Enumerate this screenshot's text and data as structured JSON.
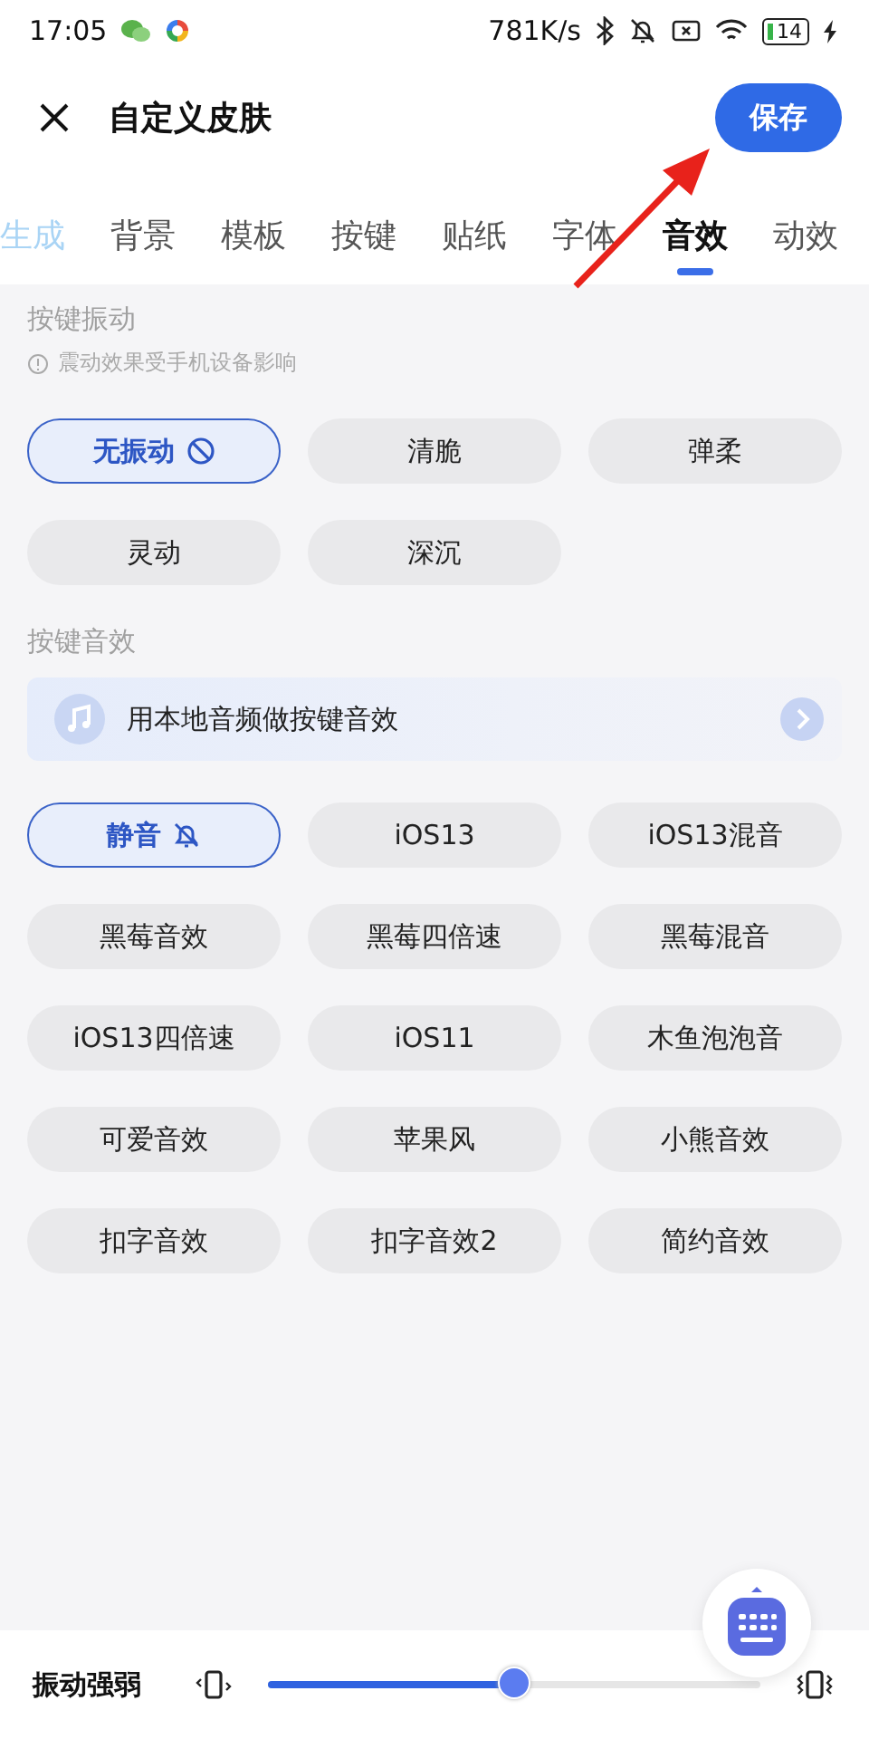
{
  "status_bar": {
    "time": "17:05",
    "speed": "781K/s",
    "battery": "14"
  },
  "header": {
    "title": "自定义皮肤",
    "save_button": "保存"
  },
  "tabs": [
    {
      "label": "生成",
      "selected": false,
      "faded": true
    },
    {
      "label": "背景",
      "selected": false
    },
    {
      "label": "模板",
      "selected": false
    },
    {
      "label": "按键",
      "selected": false
    },
    {
      "label": "贴纸",
      "selected": false
    },
    {
      "label": "字体",
      "selected": false
    },
    {
      "label": "音效",
      "selected": true
    },
    {
      "label": "动效",
      "selected": false
    }
  ],
  "vibration": {
    "title": "按键振动",
    "note": "震动效果受手机设备影响",
    "options": [
      {
        "label": "无振动",
        "selected": true
      },
      {
        "label": "清脆",
        "selected": false
      },
      {
        "label": "弹柔",
        "selected": false
      },
      {
        "label": "灵动",
        "selected": false
      },
      {
        "label": "深沉",
        "selected": false
      }
    ]
  },
  "sound": {
    "title": "按键音效",
    "local_audio": "用本地音频做按键音效",
    "options": [
      {
        "label": "静音",
        "selected": true
      },
      {
        "label": "iOS13",
        "selected": false
      },
      {
        "label": "iOS13混音",
        "selected": false
      },
      {
        "label": "黑莓音效",
        "selected": false
      },
      {
        "label": "黑莓四倍速",
        "selected": false
      },
      {
        "label": "黑莓混音",
        "selected": false
      },
      {
        "label": "iOS13四倍速",
        "selected": false
      },
      {
        "label": "iOS11",
        "selected": false
      },
      {
        "label": "木鱼泡泡音",
        "selected": false
      },
      {
        "label": "可爱音效",
        "selected": false
      },
      {
        "label": "苹果风",
        "selected": false
      },
      {
        "label": "小熊音效",
        "selected": false
      },
      {
        "label": "扣字音效",
        "selected": false
      },
      {
        "label": "扣字音效2",
        "selected": false
      },
      {
        "label": "简约音效",
        "selected": false
      }
    ]
  },
  "strength": {
    "label": "振动强弱",
    "level": 0.5
  }
}
